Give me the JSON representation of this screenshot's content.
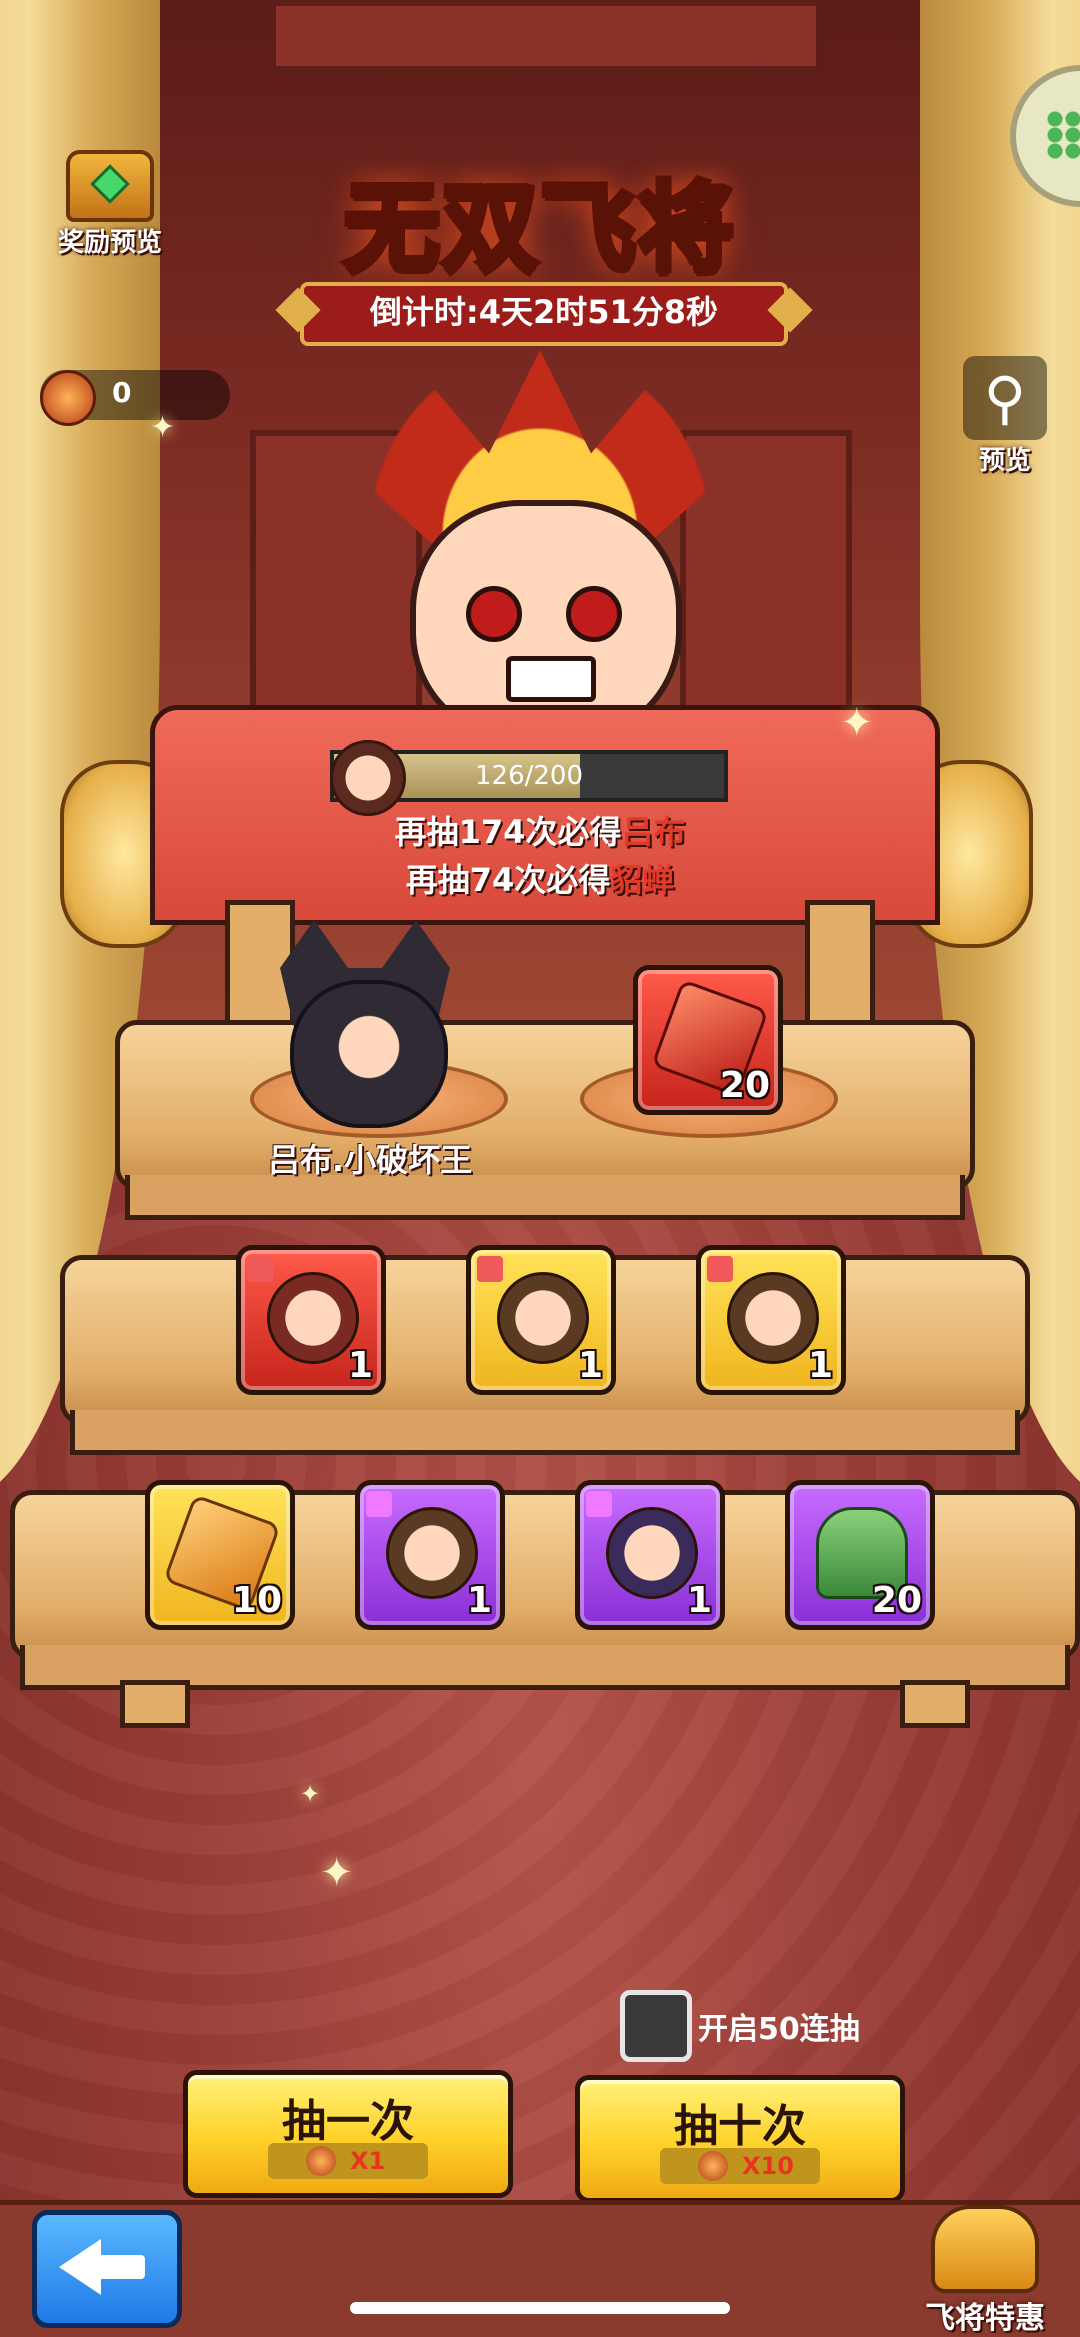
{
  "event": {
    "title": "无双飞将",
    "countdown": "倒计时:4天2时51分8秒"
  },
  "top_left": {
    "reward_preview_label": "奖励预览"
  },
  "currency": {
    "value": "0"
  },
  "top_right": {
    "preview_label": "预览"
  },
  "pity": {
    "progress_text": "126/200",
    "progress_fraction": 0.63,
    "line1_prefix": "再抽174次必得",
    "line1_hero": "吕布",
    "line2_prefix": "再抽74次必得",
    "line2_hero": "貂蝉"
  },
  "featured": {
    "character_name": "吕布.小破坏王",
    "item_count": "20"
  },
  "shelf_row2": [
    {
      "color": "red",
      "art": "face1",
      "count": "1"
    },
    {
      "color": "gold",
      "art": "face2",
      "count": "1"
    },
    {
      "color": "gold",
      "art": "face2",
      "count": "1"
    }
  ],
  "shelf_row3": [
    {
      "color": "gold",
      "art": "gem-gold",
      "count": "10"
    },
    {
      "color": "purple",
      "art": "face2",
      "count": "1"
    },
    {
      "color": "purple",
      "art": "face3",
      "count": "1"
    },
    {
      "color": "purple",
      "art": "turtle",
      "count": "20"
    }
  ],
  "controls": {
    "fifty_draw_label": "开启50连抽",
    "draw_once_label": "抽一次",
    "draw_once_cost": "X1",
    "draw_ten_label": "抽十次",
    "draw_ten_cost": "X10",
    "offer_label": "飞将特惠"
  }
}
